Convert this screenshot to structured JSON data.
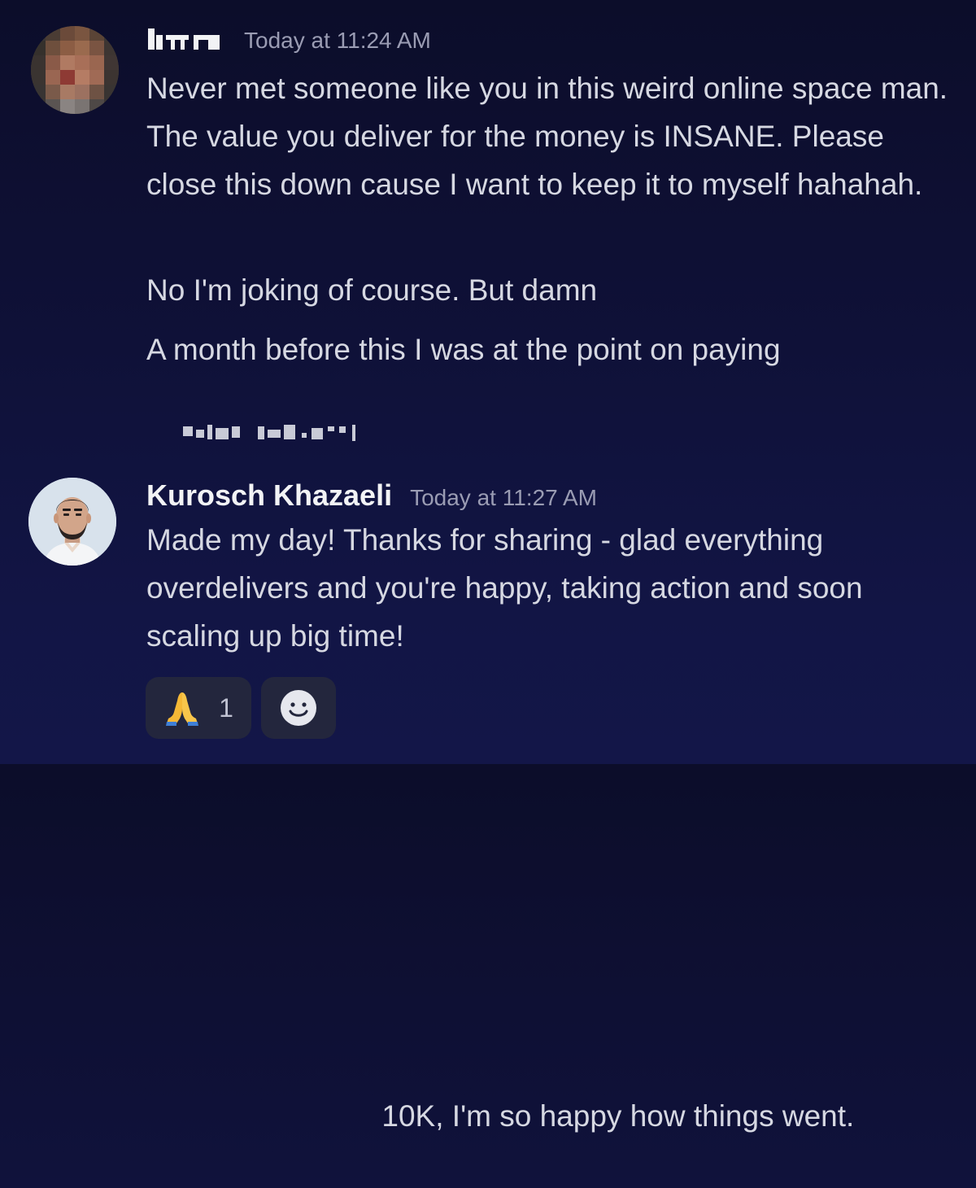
{
  "messages": [
    {
      "author": "",
      "timestamp": "Today at 11:24 AM",
      "paragraphs": [
        "Never met someone like you in this weird online space man. The value you deliver for the money is INSANE. Please close this down cause I want to keep it to myself hahahah.",
        "No I'm joking of course. But damn",
        "A month before this I was at the point on paying",
        " 10K, I'm so happy how things went."
      ]
    },
    {
      "author": "Kurosch Khazaeli",
      "timestamp": "Today at 11:27 AM",
      "paragraphs": [
        "Made my day! Thanks for sharing - glad everything overdelivers and you're happy, taking action and soon scaling up big time!"
      ]
    }
  ],
  "reactions": [
    {
      "emoji": "folded-hands",
      "count": "1"
    },
    {
      "emoji": "add-reaction-smiley"
    }
  ],
  "colors": {
    "background_top": "#0c0d2a",
    "background_bottom": "#131648",
    "username": "#f2f3f5",
    "timestamp": "#9a9cb3",
    "message_text": "#d6d8e2",
    "reaction_bg": "#23263d"
  }
}
